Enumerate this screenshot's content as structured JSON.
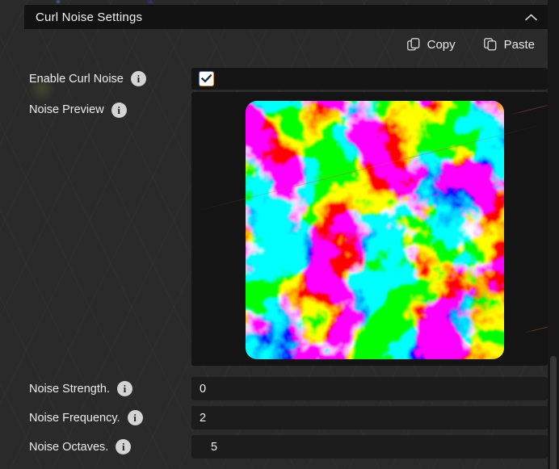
{
  "panel": {
    "title": "Curl Noise Settings",
    "collapsed": false,
    "toolbar": {
      "copy": "Copy",
      "paste": "Paste"
    },
    "fields": {
      "enable": {
        "label": "Enable Curl Noise",
        "checked": true
      },
      "preview": {
        "label": "Noise Preview"
      },
      "strength": {
        "label": "Noise Strength.",
        "value": "0"
      },
      "frequency": {
        "label": "Noise Frequency.",
        "value": "2"
      },
      "octaves": {
        "label": "Noise Octaves.",
        "value": "5"
      }
    }
  },
  "glyphs": {
    "info": "i"
  },
  "icons": [
    "chevron-up-icon",
    "copy-icon",
    "paste-icon",
    "info-icon",
    "check-icon"
  ],
  "colors": {
    "panel_bg": "#2a2a2a",
    "header_bg": "#121212",
    "row_bg": "#151515",
    "field_bg": "#1c1c1c",
    "text": "#ececec",
    "info_icon_bg": "#d4d4d4",
    "checkbox_accent": "#d9892f",
    "scrollbar_thumb": "#363636"
  }
}
